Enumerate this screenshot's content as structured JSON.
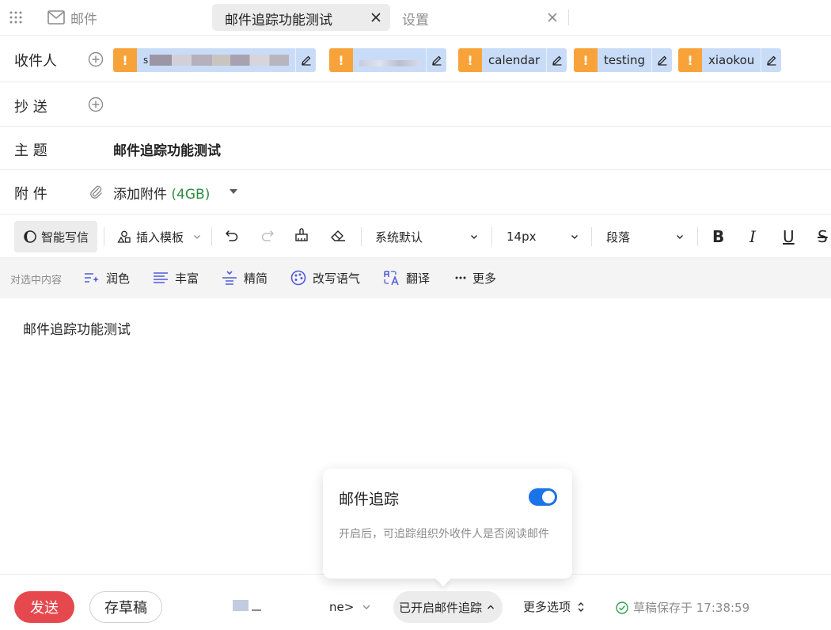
{
  "tabs": {
    "mail_label": "邮件",
    "active_label": "邮件追踪功能测试",
    "settings_label": "设置"
  },
  "recipients": {
    "label": "收件人",
    "chips": [
      {
        "name": "s",
        "blurred": true
      },
      {
        "name": "",
        "blurred": true
      },
      {
        "name": "calendar",
        "blurred": false
      },
      {
        "name": "testing",
        "blurred": false
      },
      {
        "name": "xiaokou",
        "blurred": false
      }
    ],
    "warn_glyph": "!"
  },
  "cc": {
    "label": "抄 送"
  },
  "subject": {
    "label": "主 题",
    "value": "邮件追踪功能测试"
  },
  "attachments": {
    "label": "附 件",
    "add_text": "添加附件",
    "size": "(4GB)"
  },
  "toolbar": {
    "ai_write": "智能写信",
    "insert_template": "插入模板",
    "font_family": "系统默认",
    "font_size": "14px",
    "paragraph": "段落",
    "bold": "B",
    "italic": "I",
    "underline": "U",
    "strike": "S"
  },
  "ai_bar": {
    "label": "对选中内容",
    "actions": [
      "润色",
      "丰富",
      "精简",
      "改写语气",
      "翻译",
      "更多"
    ]
  },
  "editor": {
    "body": "邮件追踪功能测试"
  },
  "popover": {
    "title": "邮件追踪",
    "enabled": true,
    "description": "开启后，可追踪组织外收件人是否阅读邮件"
  },
  "footer": {
    "send": "发送",
    "save_draft": "存草稿",
    "from_suffix": "ne>",
    "tracking": "已开启邮件追踪",
    "more_options": "更多选项",
    "saved_status": "草稿保存于 17:38:59"
  },
  "colors": {
    "send": "#e5484d",
    "warn": "#f7a33a",
    "chip": "#c9dcf7",
    "toggle": "#1a73e8",
    "attach_size": "#2e8b3e",
    "saved_check": "#2e9e4f"
  }
}
